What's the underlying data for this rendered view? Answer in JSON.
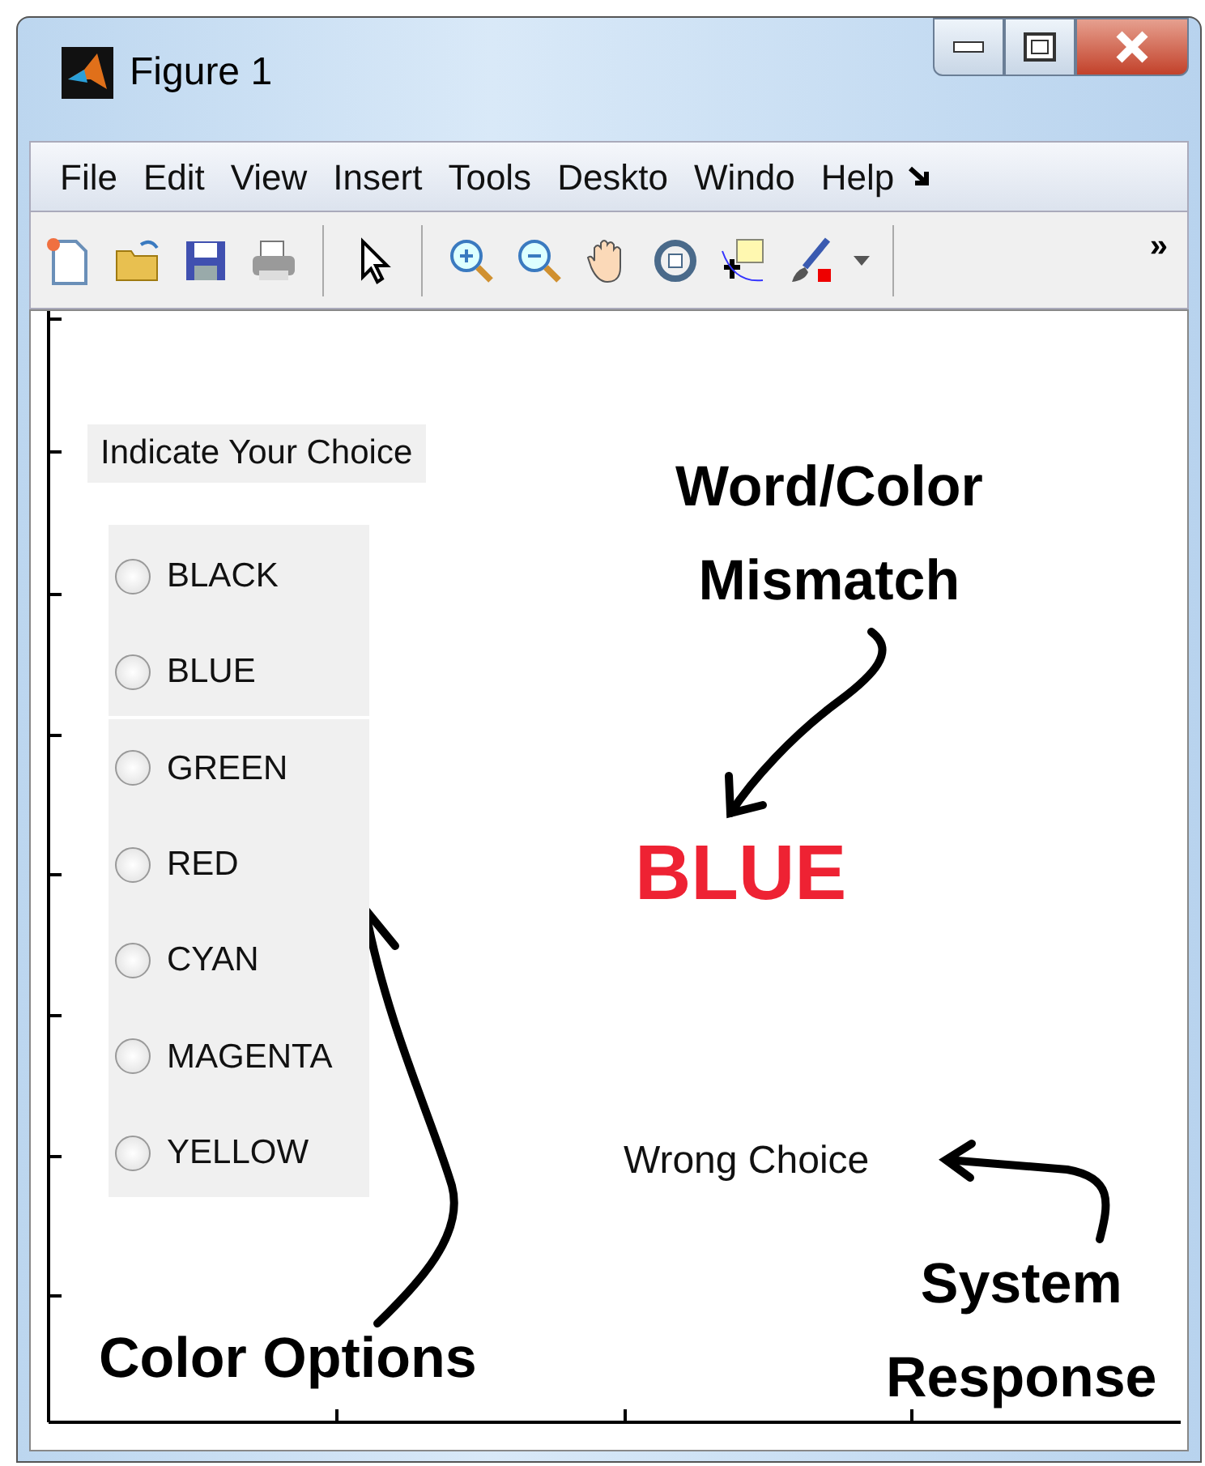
{
  "window": {
    "title": "Figure 1"
  },
  "menu": [
    "File",
    "Edit",
    "View",
    "Insert",
    "Tools",
    "Deskto",
    "Windo",
    "Help"
  ],
  "toolbar_overflow": "»",
  "panel_title": "Indicate Your Choice",
  "options": [
    {
      "label": "BLACK",
      "selected": false
    },
    {
      "label": "BLUE",
      "selected": false
    },
    {
      "label": "GREEN",
      "selected": false
    },
    {
      "label": "RED",
      "selected": false
    },
    {
      "label": "CYAN",
      "selected": false
    },
    {
      "label": "MAGENTA",
      "selected": false
    },
    {
      "label": "YELLOW",
      "selected": false
    }
  ],
  "stimulus": "BLUE",
  "response": "Wrong Choice",
  "annotations": [
    {
      "kind": "mismatch",
      "lines": [
        "Word/Color",
        "Mismatch"
      ]
    },
    {
      "kind": "options",
      "lines": [
        "Color Options"
      ]
    },
    {
      "kind": "response",
      "lines": [
        "System",
        "Response"
      ]
    }
  ]
}
